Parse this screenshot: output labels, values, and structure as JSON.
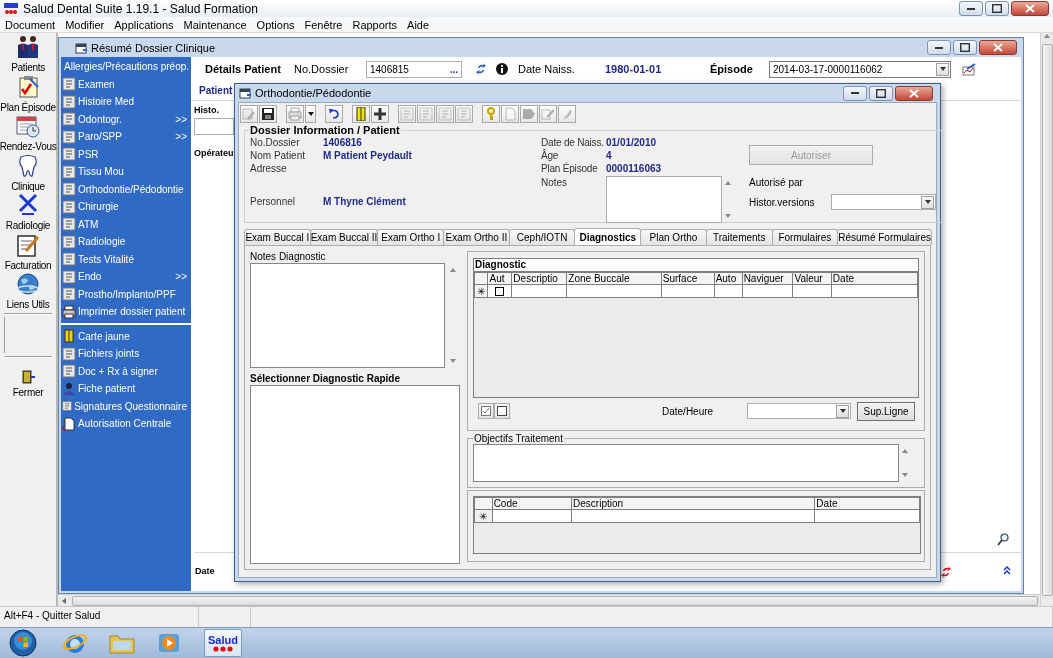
{
  "app": {
    "title": "Salud Dental Suite 1.19.1 - Salud Formation",
    "menu": [
      "Document",
      "Modifier",
      "Applications",
      "Maintenance",
      "Options",
      "Fenêtre",
      "Rapports",
      "Aide"
    ]
  },
  "launcher": [
    {
      "label": "Patients"
    },
    {
      "label": "Plan Épisode"
    },
    {
      "label": "Rendez-Vous"
    },
    {
      "label": "Clinique"
    },
    {
      "label": "Radiologie"
    },
    {
      "label": "Facturation"
    },
    {
      "label": "Liens Utils"
    }
  ],
  "launcher_exit": {
    "label": "Fermer"
  },
  "clinical_window": {
    "title": "Résumé Dossier Clinique",
    "nav": [
      {
        "label": "Allergies/Précautions préop."
      },
      {
        "label": "Examen"
      },
      {
        "label": "Histoire Med"
      },
      {
        "label": "Odontogr.",
        "arrow": ">>"
      },
      {
        "label": "Paro/SPP",
        "arrow": ">>"
      },
      {
        "label": "PSR"
      },
      {
        "label": "Tissu Mou"
      },
      {
        "label": "Orthodontie/Pédodontie"
      },
      {
        "label": "Chirurgie"
      },
      {
        "label": "ATM"
      },
      {
        "label": "Radiologie"
      },
      {
        "label": "Tests Vitalité"
      },
      {
        "label": "Endo",
        "arrow": ">>"
      },
      {
        "label": "Prostho/Implanto/PPF"
      },
      {
        "label": "Imprimer dossier patient"
      }
    ],
    "links": [
      {
        "label": "Carte jaune"
      },
      {
        "label": "Fichiers joints"
      },
      {
        "label": "Doc + Rx à signer"
      },
      {
        "label": "Fiche patient"
      },
      {
        "label": "Signatures Questionnaire"
      },
      {
        "label": "Autorisation Centrale"
      }
    ],
    "header": {
      "section": "Détails Patient",
      "dossier_label": "No.Dossier",
      "dossier_value": "1406815",
      "browse": "...",
      "birth_label": "Date Naiss.",
      "birth_value": "1980-01-01",
      "episode_label": "Épisode",
      "episode_value": "2014-03-17-0000116062"
    },
    "patient_label": "Patient",
    "history_label": "Histo.",
    "operator_label": "Opérateu",
    "date_label": "Date"
  },
  "dialog": {
    "title": "Orthodontie/Pédodontie",
    "toolbar": [
      {
        "disabled": true
      },
      {
        "disabled": false
      },
      {
        "disabled": true
      },
      {
        "disabled": false
      },
      {
        "disabled": false
      },
      {
        "disabled": false
      },
      {
        "disabled": false
      },
      {
        "disabled": true
      },
      {
        "disabled": true
      },
      {
        "disabled": true
      },
      {
        "disabled": true
      },
      {
        "disabled": false
      },
      {
        "disabled": true
      },
      {
        "disabled": true
      },
      {
        "disabled": true
      },
      {
        "disabled": true
      }
    ],
    "info": {
      "legend": "Dossier Information / Patient",
      "left": [
        {
          "label": "No.Dossier",
          "value": "1406816"
        },
        {
          "label": "Nom Patient",
          "value": "M Patient Peydault"
        },
        {
          "label": "Adresse"
        },
        {
          "label": "Personnel",
          "value": "M Thyne Clément"
        }
      ],
      "right": [
        {
          "label": "Date de Naiss.",
          "value": "01/01/2010"
        },
        {
          "label": "Âge",
          "value": "4"
        },
        {
          "label": "Plan Épisode",
          "value": "0000116063"
        }
      ],
      "notes_label": "Notes",
      "authorize_button": {
        "label": "Autoriser",
        "disabled": true
      },
      "authorized_by_label": "Autorisé par",
      "versions_label": "Histor.versions"
    },
    "tabs": [
      {
        "label": "Exam Buccal I",
        "selected": false
      },
      {
        "label": "Exam Buccal II",
        "selected": false
      },
      {
        "label": "Exam Ortho I",
        "selected": false
      },
      {
        "label": "Exam Ortho II",
        "selected": false
      },
      {
        "label": "Ceph/IOTN",
        "selected": false
      },
      {
        "label": "Diagnostics",
        "selected": true
      },
      {
        "label": "Plan Ortho",
        "selected": false
      },
      {
        "label": "Traitements",
        "selected": false
      },
      {
        "label": "Formulaires",
        "selected": false
      },
      {
        "label": "Résumé Formulaires",
        "selected": false
      }
    ],
    "panel": {
      "notes_label": "Notes Diagnostic",
      "quick_label": "Sélectionner Diagnostic Rapide",
      "diagnostic_grid": {
        "title": "Diagnostic",
        "columns": [
          "Aut",
          "Descriptio",
          "Zone Buccale",
          "Surface",
          "Auto",
          "Naviguer",
          "Valeur",
          "Date"
        ],
        "new_row": {
          "marker": "✳",
          "checked": false
        }
      },
      "datetime_label": "Date/Heure",
      "delete_button": "Sup.Ligne",
      "objectives_label": "Objectifs Traitement",
      "code_grid": {
        "columns": [
          "Code",
          "Description",
          "Date"
        ],
        "new_row": {
          "marker": "✳"
        }
      }
    }
  },
  "status_bar": [
    "Alt+F4 - Quitter Salud"
  ],
  "taskbar": {
    "active_label": "Salud"
  }
}
